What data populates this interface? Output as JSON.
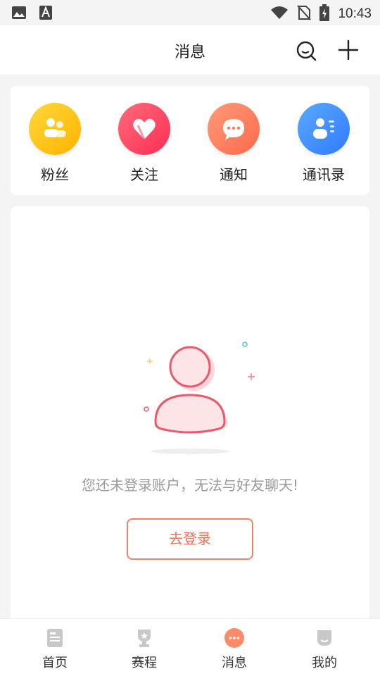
{
  "status_bar": {
    "time": "10:43",
    "icons": [
      "image-icon",
      "a-icon",
      "wifi-icon",
      "no-sim-icon",
      "battery-charging-icon"
    ]
  },
  "header": {
    "title": "消息",
    "icons": [
      "search-icon",
      "plus-icon"
    ]
  },
  "quick_actions": [
    {
      "label": "粉丝",
      "icon": "fans-icon",
      "color": "#ffc107"
    },
    {
      "label": "关注",
      "icon": "heart-icon",
      "color": "#ff3d5a"
    },
    {
      "label": "通知",
      "icon": "chat-bubble-icon",
      "color": "#ff7a5c"
    },
    {
      "label": "通讯录",
      "icon": "contacts-icon",
      "color": "#3d8bff"
    }
  ],
  "empty_state": {
    "illustration": "user-avatar-icon",
    "message": "您还未登录账户，无法与好友聊天!",
    "login_button": "去登录"
  },
  "tabbar": {
    "active": "消息",
    "tabs": [
      {
        "label": "首页",
        "icon": "home-doc-icon"
      },
      {
        "label": "赛程",
        "icon": "trophy-icon"
      },
      {
        "label": "消息",
        "icon": "message-icon"
      },
      {
        "label": "我的",
        "icon": "profile-icon"
      }
    ]
  },
  "colors": {
    "accent": "#f07058",
    "active_tab": "#ff7a5c",
    "inactive_tab": "#c8c8c8"
  }
}
